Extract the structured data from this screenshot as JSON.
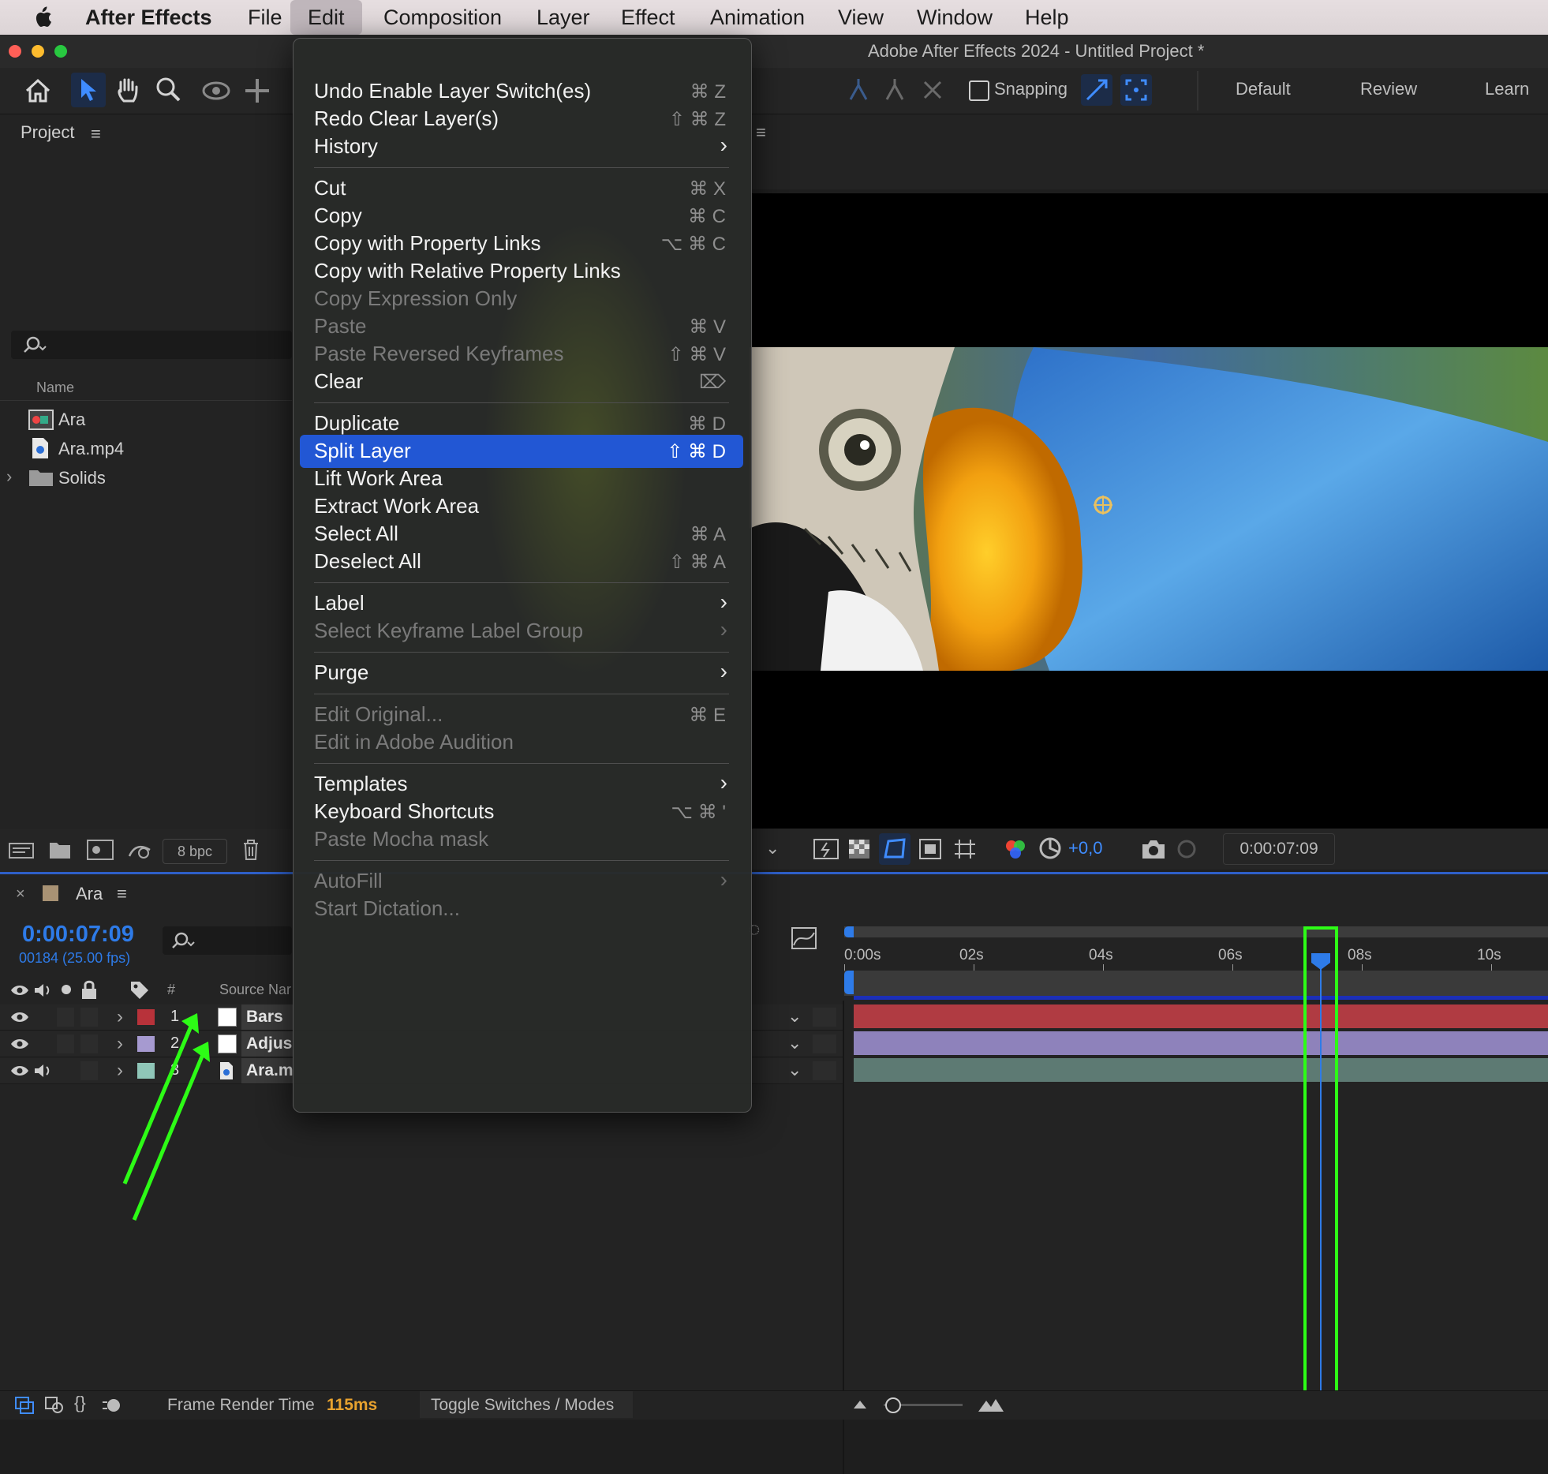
{
  "menubar": {
    "apple_icon": "apple-logo",
    "app": "After Effects",
    "items": [
      "File",
      "Edit",
      "Composition",
      "Layer",
      "Effect",
      "Animation",
      "View",
      "Window",
      "Help"
    ]
  },
  "window": {
    "title": "Adobe After Effects 2024 - Untitled Project *"
  },
  "toolbar": {
    "snapping": "Snapping",
    "workspaces": [
      "Default",
      "Review",
      "Learn"
    ]
  },
  "project": {
    "title": "Project",
    "column_name": "Name",
    "items": [
      "Ara",
      "Ara.mp4",
      "Solids"
    ],
    "bpc": "8 bpc"
  },
  "viewer": {
    "exposure": "+0,0",
    "timecode": "0:00:07:09"
  },
  "edit_menu": {
    "items": [
      {
        "label": "Undo Enable Layer Switch(es)",
        "shortcut": "⌘ Z"
      },
      {
        "label": "Redo Clear Layer(s)",
        "shortcut": "⇧ ⌘ Z"
      },
      {
        "label": "History",
        "shortcut": ""
      },
      {
        "label": "Cut",
        "shortcut": "⌘ X"
      },
      {
        "label": "Copy",
        "shortcut": "⌘ C"
      },
      {
        "label": "Copy with Property Links",
        "shortcut": "⌥ ⌘ C"
      },
      {
        "label": "Copy with Relative Property Links",
        "shortcut": ""
      },
      {
        "label": "Copy Expression Only",
        "shortcut": ""
      },
      {
        "label": "Paste",
        "shortcut": "⌘ V"
      },
      {
        "label": "Paste Reversed Keyframes",
        "shortcut": "⇧ ⌘ V"
      },
      {
        "label": "Clear",
        "shortcut": "⌦"
      },
      {
        "label": "Duplicate",
        "shortcut": "⌘ D"
      },
      {
        "label": "Split Layer",
        "shortcut": "⇧ ⌘ D"
      },
      {
        "label": "Lift Work Area",
        "shortcut": ""
      },
      {
        "label": "Extract Work Area",
        "shortcut": ""
      },
      {
        "label": "Select All",
        "shortcut": "⌘ A"
      },
      {
        "label": "Deselect All",
        "shortcut": "⇧ ⌘ A"
      },
      {
        "label": "Label",
        "shortcut": ""
      },
      {
        "label": "Select Keyframe Label Group",
        "shortcut": ""
      },
      {
        "label": "Purge",
        "shortcut": ""
      },
      {
        "label": "Edit Original...",
        "shortcut": "⌘ E"
      },
      {
        "label": "Edit in Adobe Audition",
        "shortcut": ""
      },
      {
        "label": "Templates",
        "shortcut": ""
      },
      {
        "label": "Keyboard Shortcuts",
        "shortcut": "⌥ ⌘ '"
      },
      {
        "label": "Paste Mocha mask",
        "shortcut": ""
      },
      {
        "label": "AutoFill",
        "shortcut": ""
      },
      {
        "label": "Start Dictation...",
        "shortcut": ""
      }
    ]
  },
  "timeline": {
    "comp_name": "Ara",
    "timecode": "0:00:07:09",
    "frames": "00184 (25.00 fps)",
    "col_hash": "#",
    "col_source": "Source Nar",
    "layers": [
      {
        "num": "1",
        "name": "Bars",
        "label_color": "#b8323a"
      },
      {
        "num": "2",
        "name": "Adjus",
        "label_color": "#a69ad0"
      },
      {
        "num": "3",
        "name": "Ara.m",
        "label_color": "#8fc6b8"
      }
    ],
    "ruler": [
      "0:00s",
      "02s",
      "04s",
      "06s",
      "08s",
      "10s"
    ],
    "playhead_seconds": 7.36
  },
  "statusbar": {
    "frame_render_label": "Frame Render Time",
    "frame_render_value": "115ms",
    "toggle": "Toggle Switches / Modes"
  },
  "colors": {
    "accent_blue": "#2e7be8",
    "highlight": "#2257d4",
    "annotation_green": "#2dfc16"
  }
}
